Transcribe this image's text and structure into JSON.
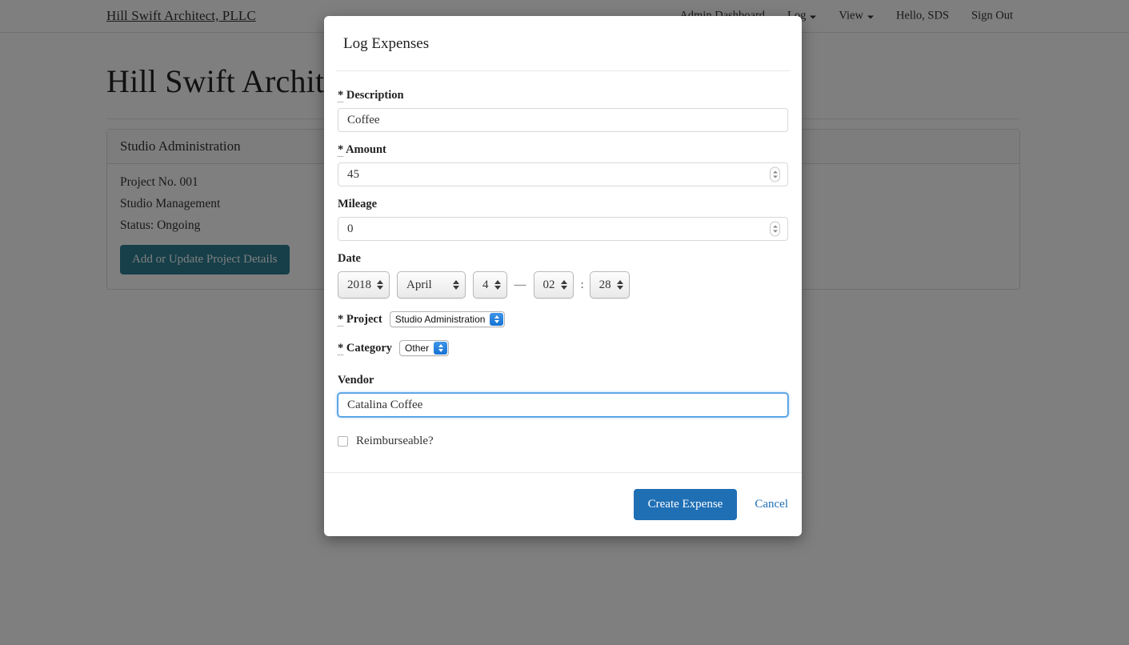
{
  "navbar": {
    "brand": "Hill Swift Architect, PLLC",
    "links": [
      {
        "label": "Admin Dashboard",
        "has_caret": false
      },
      {
        "label": "Log",
        "has_caret": true
      },
      {
        "label": "View",
        "has_caret": true
      },
      {
        "label": "Hello, SDS",
        "has_caret": false
      },
      {
        "label": "Sign Out",
        "has_caret": false
      }
    ]
  },
  "page": {
    "title": "Hill Swift Architect",
    "panel": {
      "heading": "Studio Administration",
      "lines": [
        "Project No. 001",
        "Studio Management",
        "Status: Ongoing"
      ],
      "button_label": "Add or Update Project Details",
      "button_color": "#2d7f93"
    }
  },
  "modal": {
    "title": "Log Expenses",
    "fields": {
      "description": {
        "required_mark": "*",
        "label": "Description",
        "value": "Coffee"
      },
      "amount": {
        "required_mark": "*",
        "label": "Amount",
        "value": "45"
      },
      "mileage": {
        "required_mark": "",
        "label": "Mileage",
        "value": "0"
      },
      "date": {
        "label": "Date",
        "year": "2018",
        "month": "April",
        "day": "4",
        "separator": "—",
        "hour": "02",
        "time_separator": ":",
        "minute": "28"
      },
      "project": {
        "required_mark": "*",
        "label": "Project",
        "value": "Studio Administration"
      },
      "category": {
        "required_mark": "*",
        "label": "Category",
        "value": "Other"
      },
      "vendor": {
        "required_mark": "",
        "label": "Vendor",
        "value": "Catalina Coffee",
        "focused": true
      },
      "reimburseable": {
        "label": "Reimburseable?",
        "checked": false
      }
    },
    "footer": {
      "submit_label": "Create Expense",
      "cancel_label": "Cancel",
      "submit_color": "#1f6fb5"
    }
  }
}
